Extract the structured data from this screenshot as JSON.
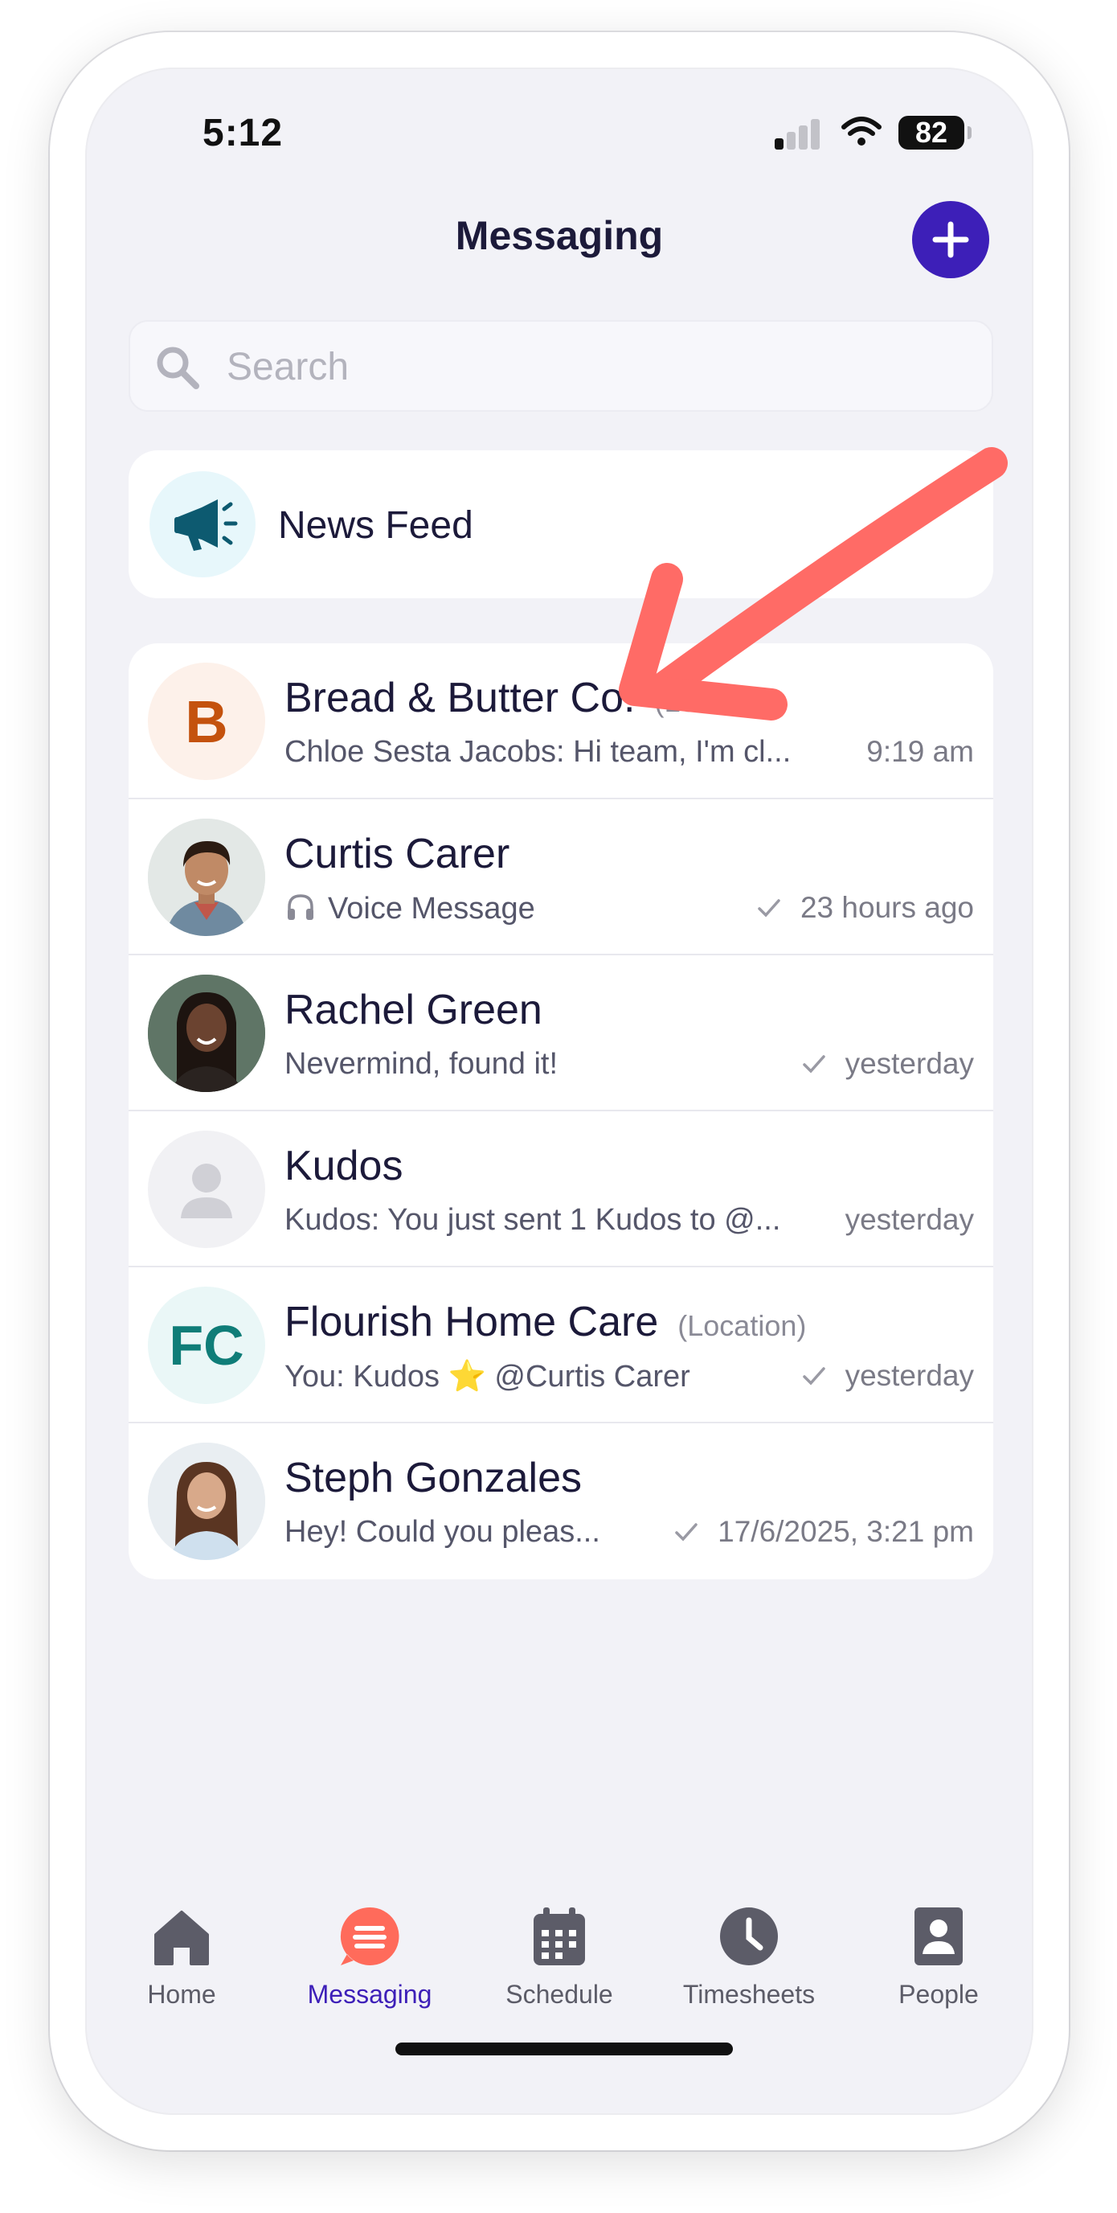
{
  "status_bar": {
    "time": "5:12",
    "battery": "82"
  },
  "header": {
    "title": "Messaging",
    "new_icon": "plus-icon"
  },
  "search": {
    "placeholder": "Search",
    "value": "",
    "icon": "search-icon"
  },
  "news_feed": {
    "label": "News Feed",
    "icon": "megaphone-icon"
  },
  "conversations": [
    {
      "name": "Bread & Butter Co.",
      "tag": "(Location)",
      "avatar_text": "B",
      "preview": "Chloe Sesta Jacobs: Hi team, I'm cl...",
      "time": "9:19 am",
      "read_check": false
    },
    {
      "name": "Curtis Carer",
      "tag": "",
      "avatar_text": "",
      "preview": "Voice Message",
      "preview_icon": "headphones-icon",
      "time": "23 hours ago",
      "read_check": true
    },
    {
      "name": "Rachel Green",
      "tag": "",
      "avatar_text": "",
      "preview": "Nevermind, found it!",
      "time": "yesterday",
      "read_check": true
    },
    {
      "name": "Kudos",
      "tag": "",
      "avatar_text": "",
      "preview": "Kudos: You just sent 1 Kudos to @...",
      "time": "yesterday",
      "read_check": false
    },
    {
      "name": "Flourish Home Care",
      "tag": "(Location)",
      "avatar_text": "FC",
      "preview": "You: Kudos ⭐ @Curtis Carer",
      "time": "yesterday",
      "read_check": true
    },
    {
      "name": "Steph Gonzales",
      "tag": "",
      "avatar_text": "",
      "preview": "Hey! Could you pleas...",
      "time": "17/6/2025, 3:21 pm",
      "read_check": true
    }
  ],
  "tabs": [
    {
      "label": "Home",
      "icon": "home-icon",
      "active": false
    },
    {
      "label": "Messaging",
      "icon": "chat-icon",
      "active": true
    },
    {
      "label": "Schedule",
      "icon": "calendar-icon",
      "active": false
    },
    {
      "label": "Timesheets",
      "icon": "clock-icon",
      "active": false
    },
    {
      "label": "People",
      "icon": "contacts-icon",
      "active": false
    }
  ],
  "colors": {
    "accent": "#3d1fb8",
    "messaging_tab": "#ff6b5b",
    "annotation_arrow": "#ff6b66",
    "screen_bg": "#f2f2f7"
  }
}
